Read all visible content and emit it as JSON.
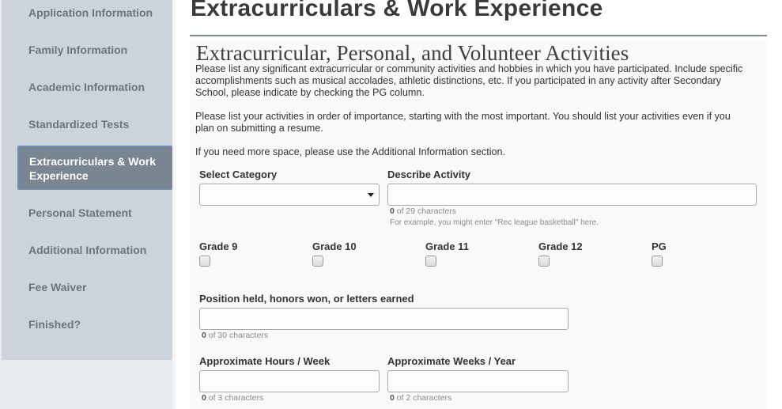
{
  "sidebar": {
    "items": [
      {
        "label": "Application Information"
      },
      {
        "label": "Family Information"
      },
      {
        "label": "Academic Information"
      },
      {
        "label": "Standardized Tests"
      },
      {
        "label": "Extracurriculars & Work Experience",
        "active": true
      },
      {
        "label": "Personal Statement"
      },
      {
        "label": "Additional Information"
      },
      {
        "label": "Fee Waiver"
      },
      {
        "label": "Finished?"
      }
    ]
  },
  "page": {
    "title": "Extracurriculars & Work Experience"
  },
  "section": {
    "heading": "Extracurricular, Personal, and Volunteer Activities",
    "paragraph1": "Please list any significant extracurricular or community activities and hobbies in which you have participated. Include specific accomplishments such as musical accolades, athletic distinctions, etc. If you participated in any activity after Secondary School, please indicate by checking the PG column.",
    "paragraph2": "Please list your activities in order of importance, starting with the most important. You should list your activities even if you plan on submitting a resume.",
    "paragraph3": "If you need more space, please use the Additional Information section."
  },
  "form": {
    "category": {
      "label": "Select Category",
      "value": ""
    },
    "activity": {
      "label": "Describe Activity",
      "value": "",
      "count": "0",
      "counter_suffix": " of 29 characters",
      "hint": "For example, you might enter \"Rec league basketball\" here."
    },
    "grades": [
      {
        "label": "Grade 9",
        "checked": false
      },
      {
        "label": "Grade 10",
        "checked": false
      },
      {
        "label": "Grade 11",
        "checked": false
      },
      {
        "label": "Grade 12",
        "checked": false
      },
      {
        "label": "PG",
        "checked": false
      }
    ],
    "position": {
      "label": "Position held, honors won, or letters earned",
      "value": "",
      "count": "0",
      "counter_suffix": " of 30 characters"
    },
    "hours": {
      "label": "Approximate Hours / Week",
      "value": "",
      "count": "0",
      "counter_suffix": " of 3 characters"
    },
    "weeks": {
      "label": "Approximate Weeks / Year",
      "value": "",
      "count": "0",
      "counter_suffix": " of 2 characters"
    }
  }
}
